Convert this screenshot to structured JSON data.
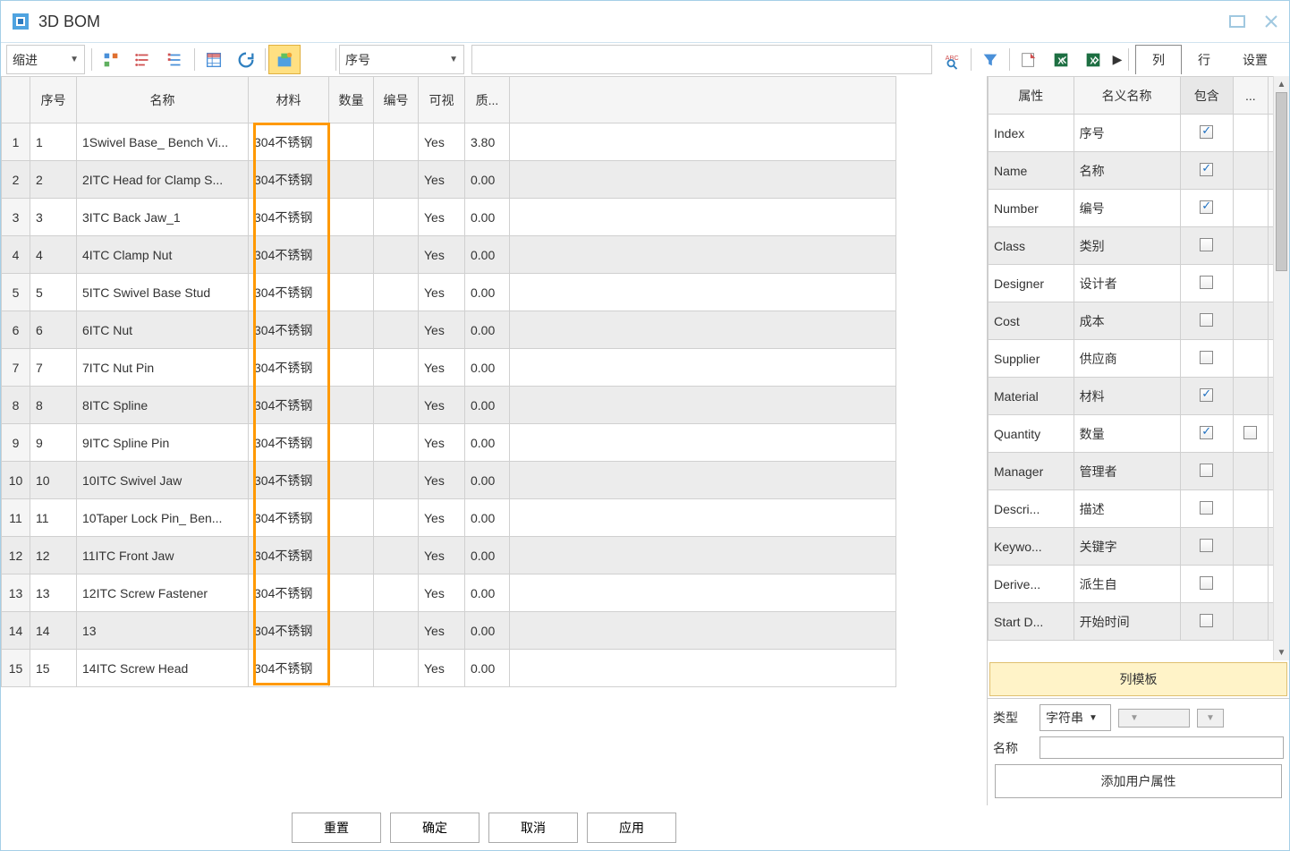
{
  "title": "3D BOM",
  "toolbar": {
    "indent_label": "缩进",
    "sort_label": "序号"
  },
  "tabs": {
    "col": "列",
    "row": "行",
    "settings": "设置"
  },
  "gridHeaders": {
    "seq": "序号",
    "name": "名称",
    "material": "材料",
    "qty": "数量",
    "number": "编号",
    "visible": "可视",
    "mass": "质..."
  },
  "rows": [
    {
      "n": "1",
      "seq": "1",
      "name": "1Swivel Base_ Bench Vi...",
      "mat": "304不锈钢",
      "num": "",
      "vis": "Yes",
      "mass": "3.80"
    },
    {
      "n": "2",
      "seq": "2",
      "name": "2ITC Head for Clamp S...",
      "mat": "304不锈钢",
      "num": "",
      "vis": "Yes",
      "mass": "0.00"
    },
    {
      "n": "3",
      "seq": "3",
      "name": "3ITC Back Jaw_1",
      "mat": "304不锈钢",
      "num": "",
      "vis": "Yes",
      "mass": "0.00"
    },
    {
      "n": "4",
      "seq": "4",
      "name": "4ITC Clamp Nut",
      "mat": "304不锈钢",
      "num": "",
      "vis": "Yes",
      "mass": "0.00"
    },
    {
      "n": "5",
      "seq": "5",
      "name": "5ITC Swivel Base Stud",
      "mat": "304不锈钢",
      "num": "",
      "vis": "Yes",
      "mass": "0.00"
    },
    {
      "n": "6",
      "seq": "6",
      "name": "6ITC Nut",
      "mat": "304不锈钢",
      "num": "",
      "vis": "Yes",
      "mass": "0.00"
    },
    {
      "n": "7",
      "seq": "7",
      "name": "7ITC Nut Pin",
      "mat": "304不锈钢",
      "num": "",
      "vis": "Yes",
      "mass": "0.00"
    },
    {
      "n": "8",
      "seq": "8",
      "name": "8ITC Spline",
      "mat": "304不锈钢",
      "num": "",
      "vis": "Yes",
      "mass": "0.00"
    },
    {
      "n": "9",
      "seq": "9",
      "name": "9ITC Spline Pin",
      "mat": "304不锈钢",
      "num": "",
      "vis": "Yes",
      "mass": "0.00"
    },
    {
      "n": "10",
      "seq": "10",
      "name": "10ITC Swivel Jaw",
      "mat": "304不锈钢",
      "num": "",
      "vis": "Yes",
      "mass": "0.00"
    },
    {
      "n": "11",
      "seq": "11",
      "name": "10Taper Lock Pin_ Ben...",
      "mat": "304不锈钢",
      "num": "",
      "vis": "Yes",
      "mass": "0.00"
    },
    {
      "n": "12",
      "seq": "12",
      "name": "11ITC Front Jaw",
      "mat": "304不锈钢",
      "num": "",
      "vis": "Yes",
      "mass": "0.00"
    },
    {
      "n": "13",
      "seq": "13",
      "name": "12ITC Screw Fastener",
      "mat": "304不锈钢",
      "num": "",
      "vis": "Yes",
      "mass": "0.00"
    },
    {
      "n": "14",
      "seq": "14",
      "name": "13",
      "mat": "304不锈钢",
      "num": "",
      "vis": "Yes",
      "mass": "0.00"
    },
    {
      "n": "15",
      "seq": "15",
      "name": "14ITC Screw Head",
      "mat": "304不锈钢",
      "num": "",
      "vis": "Yes",
      "mass": "0.00"
    }
  ],
  "propHeaders": {
    "attr": "属性",
    "nominal": "名义名称",
    "include": "包含",
    "more": "..."
  },
  "props": [
    {
      "attr": "Index",
      "nom": "序号",
      "inc": true,
      "more": false
    },
    {
      "attr": "Name",
      "nom": "名称",
      "inc": true,
      "more": false
    },
    {
      "attr": "Number",
      "nom": "编号",
      "inc": true,
      "more": false
    },
    {
      "attr": "Class",
      "nom": "类别",
      "inc": false,
      "more": false
    },
    {
      "attr": "Designer",
      "nom": "设计者",
      "inc": false,
      "more": false
    },
    {
      "attr": "Cost",
      "nom": "成本",
      "inc": false,
      "more": false
    },
    {
      "attr": "Supplier",
      "nom": "供应商",
      "inc": false,
      "more": false
    },
    {
      "attr": "Material",
      "nom": "材料",
      "inc": true,
      "more": false
    },
    {
      "attr": "Quantity",
      "nom": "数量",
      "inc": true,
      "more": true,
      "moreUnchecked": true
    },
    {
      "attr": "Manager",
      "nom": "管理者",
      "inc": false,
      "more": false
    },
    {
      "attr": "Descri...",
      "nom": "描述",
      "inc": false,
      "more": false
    },
    {
      "attr": "Keywo...",
      "nom": "关键字",
      "inc": false,
      "more": false
    },
    {
      "attr": "Derive...",
      "nom": "派生自",
      "inc": false,
      "more": false
    },
    {
      "attr": "Start D...",
      "nom": "开始时间",
      "inc": false,
      "more": false
    }
  ],
  "panel": {
    "template_btn": "列模板",
    "type_label": "类型",
    "type_value": "字符串",
    "name_label": "名称",
    "add_btn": "添加用户属性"
  },
  "footer": {
    "reset": "重置",
    "ok": "确定",
    "cancel": "取消",
    "apply": "应用"
  }
}
